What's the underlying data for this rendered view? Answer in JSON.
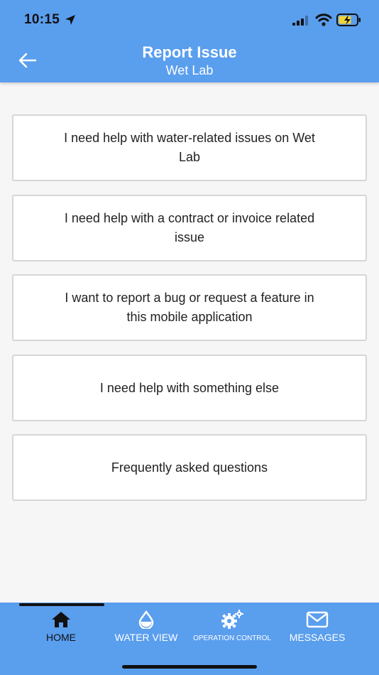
{
  "status_bar": {
    "time": "10:15"
  },
  "header": {
    "title": "Report Issue",
    "subtitle": "Wet Lab"
  },
  "options": [
    {
      "label": "I need help with water-related issues on Wet Lab"
    },
    {
      "label": "I need help with a contract or invoice related issue"
    },
    {
      "label": "I want to report a bug or request a feature in this mobile application"
    },
    {
      "label": "I need help with something else"
    },
    {
      "label": "Frequently asked questions"
    }
  ],
  "tabs": [
    {
      "label": "HOME",
      "icon": "home-icon",
      "active": true
    },
    {
      "label": "WATER VIEW",
      "icon": "water-drop-icon",
      "active": false
    },
    {
      "label": "OPERATION CONTROL",
      "icon": "gears-icon",
      "active": false
    },
    {
      "label": "MESSAGES",
      "icon": "envelope-icon",
      "active": false
    }
  ],
  "colors": {
    "header_bg": "#5a9eee",
    "page_bg": "#f6f6f6",
    "card_border": "#d6d6d6",
    "active_tab": "#111111",
    "inactive_tab": "#ffffff"
  }
}
